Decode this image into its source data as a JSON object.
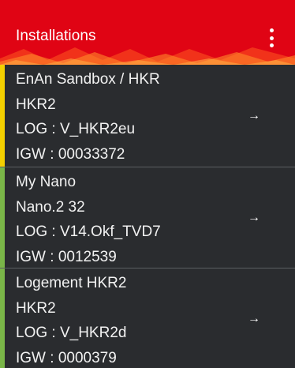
{
  "app": {
    "title": "Installations",
    "colors": {
      "brand": "#e00414",
      "background": "#2a2c2f",
      "text": "#f2f2f2"
    }
  },
  "installations": [
    {
      "name": "EnAn Sandbox / HKR",
      "type": "HKR2",
      "log": "LOG : V_HKR2eu",
      "igw": "IGW : 00033372",
      "accent": "#f4d000"
    },
    {
      "name": "My Nano",
      "type": "Nano.2 32",
      "log": "LOG : V14.Okf_TVD7",
      "igw": "IGW : 0012539",
      "accent": "#7ab648"
    },
    {
      "name": "Logement HKR2",
      "type": "HKR2",
      "log": "LOG : V_HKR2d",
      "igw": "IGW : 0000379",
      "accent": "#7ab648"
    }
  ],
  "icons": {
    "menu": "more-vertical-icon",
    "row_arrow": "arrow-right-icon"
  },
  "arrow_glyph": "→"
}
